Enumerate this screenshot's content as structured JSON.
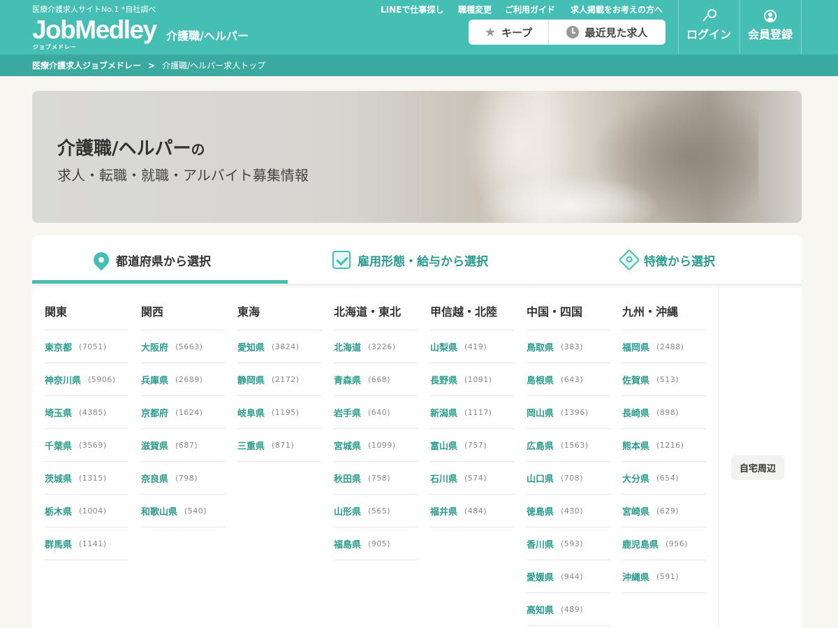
{
  "header": {
    "tagline": "医療介護求人サイトNo.1 *自社調べ",
    "logo_text": "JobMedley",
    "logo_kana": "ジョブメドレー",
    "logo_sub": "介護職/ヘルパー",
    "nav": [
      "LINEで仕事探し",
      "職種変更",
      "ご利用ガイド",
      "求人掲載をお考えの方へ"
    ],
    "keep_label": "キープ",
    "recent_label": "最近見た求人",
    "login_label": "ログイン",
    "register_label": "会員登録"
  },
  "breadcrumb": {
    "home": "医療介護求人ジョブメドレー",
    "separator": ">",
    "current": "介護職/ヘルパー求人トップ"
  },
  "hero": {
    "title": "介護職/ヘルパー",
    "title_suffix": "の",
    "subtitle": "求人・転職・就職・アルバイト募集情報"
  },
  "tabs": [
    {
      "label": "都道府県から選択",
      "icon": "pin-icon",
      "active": true
    },
    {
      "label": "雇用形態・給与から選択",
      "icon": "checkbox-icon",
      "active": false
    },
    {
      "label": "特徴から選択",
      "icon": "tag-icon",
      "active": false
    }
  ],
  "regions": [
    {
      "name": "関東",
      "prefs": [
        {
          "name": "東京都",
          "count": "(7051)"
        },
        {
          "name": "神奈川県",
          "count": "(5906)"
        },
        {
          "name": "埼玉県",
          "count": "(4385)"
        },
        {
          "name": "千葉県",
          "count": "(3569)"
        },
        {
          "name": "茨城県",
          "count": "(1315)"
        },
        {
          "name": "栃木県",
          "count": "(1004)"
        },
        {
          "name": "群馬県",
          "count": "(1141)"
        }
      ]
    },
    {
      "name": "関西",
      "prefs": [
        {
          "name": "大阪府",
          "count": "(5663)"
        },
        {
          "name": "兵庫県",
          "count": "(2689)"
        },
        {
          "name": "京都府",
          "count": "(1624)"
        },
        {
          "name": "滋賀県",
          "count": "(687)"
        },
        {
          "name": "奈良県",
          "count": "(798)"
        },
        {
          "name": "和歌山県",
          "count": "(540)"
        }
      ]
    },
    {
      "name": "東海",
      "prefs": [
        {
          "name": "愛知県",
          "count": "(3824)"
        },
        {
          "name": "静岡県",
          "count": "(2172)"
        },
        {
          "name": "岐阜県",
          "count": "(1195)"
        },
        {
          "name": "三重県",
          "count": "(871)"
        }
      ]
    },
    {
      "name": "北海道・東北",
      "prefs": [
        {
          "name": "北海道",
          "count": "(3226)"
        },
        {
          "name": "青森県",
          "count": "(668)"
        },
        {
          "name": "岩手県",
          "count": "(640)"
        },
        {
          "name": "宮城県",
          "count": "(1099)"
        },
        {
          "name": "秋田県",
          "count": "(758)"
        },
        {
          "name": "山形県",
          "count": "(565)"
        },
        {
          "name": "福島県",
          "count": "(905)"
        }
      ]
    },
    {
      "name": "甲信越・北陸",
      "prefs": [
        {
          "name": "山梨県",
          "count": "(419)"
        },
        {
          "name": "長野県",
          "count": "(1091)"
        },
        {
          "name": "新潟県",
          "count": "(1117)"
        },
        {
          "name": "富山県",
          "count": "(757)"
        },
        {
          "name": "石川県",
          "count": "(574)"
        },
        {
          "name": "福井県",
          "count": "(484)"
        }
      ]
    },
    {
      "name": "中国・四国",
      "prefs": [
        {
          "name": "鳥取県",
          "count": "(383)"
        },
        {
          "name": "島根県",
          "count": "(643)"
        },
        {
          "name": "岡山県",
          "count": "(1396)"
        },
        {
          "name": "広島県",
          "count": "(1563)"
        },
        {
          "name": "山口県",
          "count": "(708)"
        },
        {
          "name": "徳島県",
          "count": "(430)"
        },
        {
          "name": "香川県",
          "count": "(593)"
        },
        {
          "name": "愛媛県",
          "count": "(944)"
        },
        {
          "name": "高知県",
          "count": "(489)"
        }
      ]
    },
    {
      "name": "九州・沖縄",
      "prefs": [
        {
          "name": "福岡県",
          "count": "(2488)"
        },
        {
          "name": "佐賀県",
          "count": "(513)"
        },
        {
          "name": "長崎県",
          "count": "(898)"
        },
        {
          "name": "熊本県",
          "count": "(1216)"
        },
        {
          "name": "大分県",
          "count": "(654)"
        },
        {
          "name": "宮崎県",
          "count": "(629)"
        },
        {
          "name": "鹿児島県",
          "count": "(956)"
        },
        {
          "name": "沖縄県",
          "count": "(591)"
        }
      ]
    }
  ],
  "near_home_label": "自宅周辺",
  "colors": {
    "brand": "#45bfb4",
    "breadcrumb_bg": "#3aa99f",
    "link": "#2c9b90",
    "page_bg": "#f8f6f1"
  }
}
